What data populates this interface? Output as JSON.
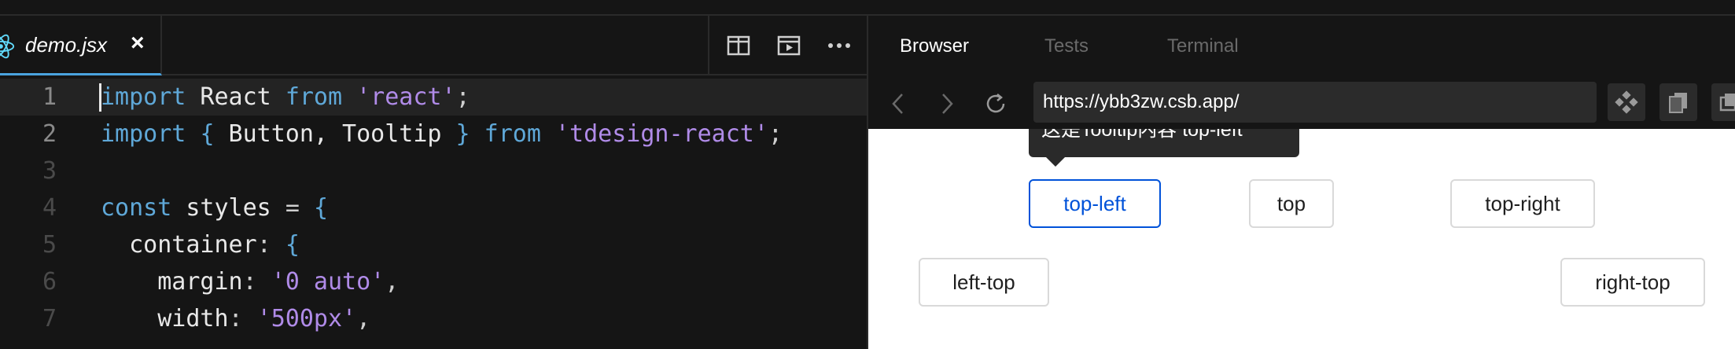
{
  "editor": {
    "tab": {
      "icon": "react-icon",
      "label": "demo.jsx",
      "close": "×"
    },
    "actions": [
      "split-editor-icon",
      "open-preview-icon",
      "more-icon"
    ],
    "lines": [
      {
        "n": "1",
        "tokens": [
          {
            "t": "kw",
            "v": "import"
          },
          {
            "t": "id",
            "v": " React "
          },
          {
            "t": "kw",
            "v": "from"
          },
          {
            "t": "pl",
            "v": " "
          },
          {
            "t": "str",
            "v": "'react'"
          },
          {
            "t": "pl",
            "v": ";"
          }
        ]
      },
      {
        "n": "2",
        "tokens": [
          {
            "t": "kw",
            "v": "import"
          },
          {
            "t": "pl",
            "v": " "
          },
          {
            "t": "br",
            "v": "{"
          },
          {
            "t": "id",
            "v": " Button, Tooltip "
          },
          {
            "t": "br",
            "v": "}"
          },
          {
            "t": "pl",
            "v": " "
          },
          {
            "t": "kw",
            "v": "from"
          },
          {
            "t": "pl",
            "v": " "
          },
          {
            "t": "str",
            "v": "'tdesign-react'"
          },
          {
            "t": "pl",
            "v": ";"
          }
        ]
      },
      {
        "n": "3",
        "tokens": []
      },
      {
        "n": "4",
        "tokens": [
          {
            "t": "kw",
            "v": "const"
          },
          {
            "t": "id",
            "v": " styles "
          },
          {
            "t": "pl",
            "v": "= "
          },
          {
            "t": "br",
            "v": "{"
          }
        ]
      },
      {
        "n": "5",
        "tokens": [
          {
            "t": "id",
            "v": "  container"
          },
          {
            "t": "pl",
            "v": ": "
          },
          {
            "t": "br",
            "v": "{"
          }
        ]
      },
      {
        "n": "6",
        "tokens": [
          {
            "t": "id",
            "v": "    margin"
          },
          {
            "t": "pl",
            "v": ": "
          },
          {
            "t": "str",
            "v": "'0 auto'"
          },
          {
            "t": "pl",
            "v": ","
          }
        ]
      },
      {
        "n": "7",
        "tokens": [
          {
            "t": "id",
            "v": "    width"
          },
          {
            "t": "pl",
            "v": ": "
          },
          {
            "t": "str",
            "v": "'500px'"
          },
          {
            "t": "pl",
            "v": ","
          }
        ]
      }
    ]
  },
  "panel": {
    "tabs": [
      "Browser",
      "Tests",
      "Terminal"
    ],
    "active_tab": "Browser",
    "nav": [
      "back-icon",
      "forward-icon",
      "refresh-icon"
    ],
    "url": "https://ybb3zw.csb.app/",
    "tools": [
      "diamond-icon",
      "copy-icon",
      "window-icon"
    ]
  },
  "preview": {
    "tooltip": "这是Tooltip内容 top-left",
    "buttons": {
      "top_left": "top-left",
      "top": "top",
      "top_right": "top-right",
      "left_top": "left-top",
      "right_top": "right-top"
    },
    "accent": "#0052d9"
  }
}
